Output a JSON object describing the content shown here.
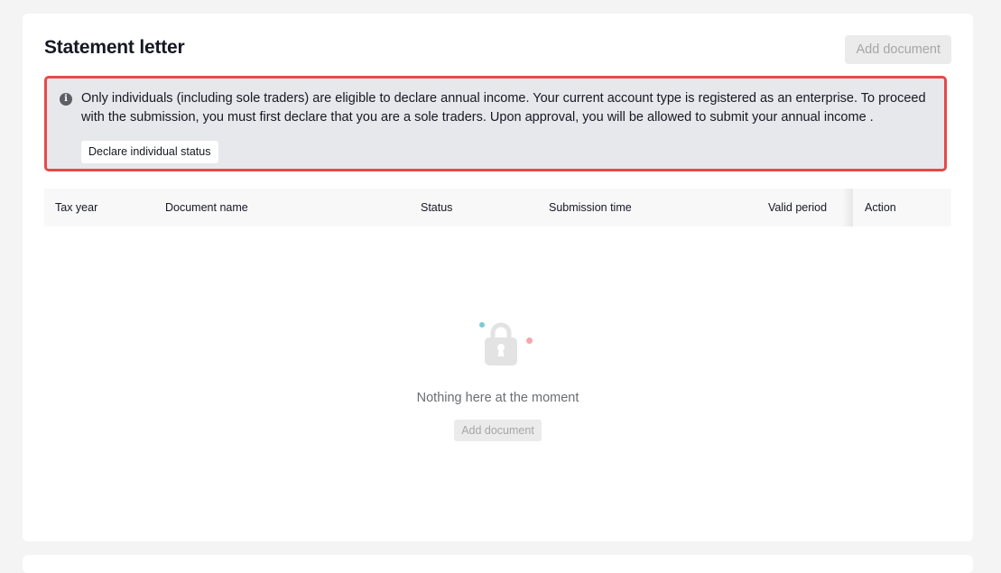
{
  "page": {
    "title": "Statement letter",
    "add_document_label": "Add document"
  },
  "notice": {
    "icon": "info-icon",
    "message": "Only individuals (including sole traders) are eligible to declare annual income. Your current account type is registered as an enterprise. To proceed with the submission, you must first declare that you are a sole traders. Upon approval, you will be allowed to submit your annual income .",
    "declare_button_label": "Declare individual status",
    "border_color": "#e54a4a"
  },
  "table": {
    "columns": [
      "Tax year",
      "Document name",
      "Status",
      "Submission time",
      "Valid period",
      "Action"
    ]
  },
  "empty_state": {
    "icon": "lock-icon",
    "message": "Nothing here at the moment",
    "add_document_label": "Add document"
  }
}
